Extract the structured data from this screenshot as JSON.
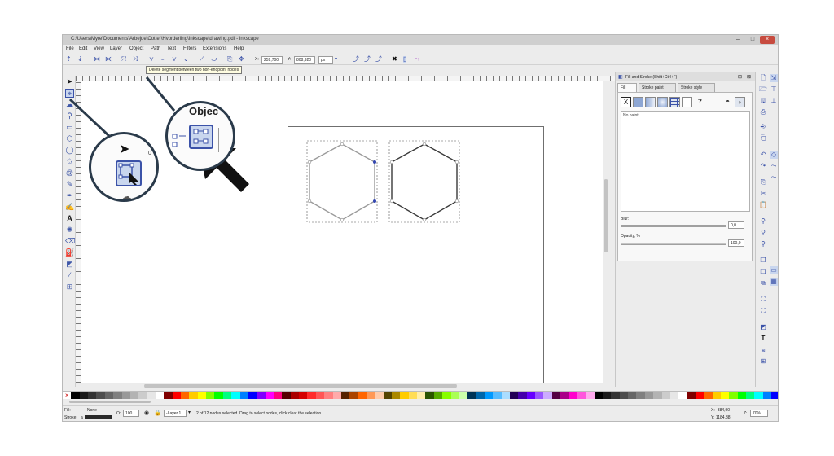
{
  "window": {
    "title": "C:\\Users\\Myre\\Documents\\Arbejde\\Cotter\\Hvorderling\\Inkscape\\drawing.pdf - Inkscape"
  },
  "menu": [
    "File",
    "Edit",
    "View",
    "Layer",
    "Object",
    "Path",
    "Text",
    "Filters",
    "Extensions",
    "Help"
  ],
  "node_toolbar": {
    "x_label": "X:",
    "x_value": "259,700",
    "y_label": "Y:",
    "y_value": "808,920",
    "unit": "px"
  },
  "tooltip": "Delete segment between two non-endpoint nodes",
  "fill_stroke": {
    "title": "Fill and Stroke (Shift+Ctrl+F)",
    "tabs": [
      "Fill",
      "Stroke paint",
      "Stroke style"
    ],
    "active_tab": "Fill",
    "paint_buttons": [
      "X",
      "?"
    ],
    "no_paint_label": "No paint",
    "blur_label": "Blur:",
    "blur_value": "0,0",
    "opacity_label": "Opacity, %",
    "opacity_value": "100,0"
  },
  "magnifier": {
    "objects_label": "Objec"
  },
  "status": {
    "fill_label": "Fill:",
    "fill_value": "None",
    "stroke_label": "Stroke:",
    "stroke_value": "a",
    "opacity_o": "O:",
    "opacity_value": "100",
    "layer": "-Layer 1",
    "message": "2 of 12 nodes selected. Drag to select nodes, click clear the selection",
    "x_coord": "X: -384,90",
    "y_coord": "Y: 1184,88",
    "zoom_label": "Z:",
    "zoom_value": "70%"
  },
  "palette_colors": [
    "#000000",
    "#1a1a1a",
    "#333333",
    "#4d4d4d",
    "#666666",
    "#808080",
    "#999999",
    "#b3b3b3",
    "#cccccc",
    "#e6e6e6",
    "#ffffff",
    "#800000",
    "#ff0000",
    "#ff6600",
    "#ffcc00",
    "#ffff00",
    "#80ff00",
    "#00ff00",
    "#00ff80",
    "#00ffff",
    "#0080ff",
    "#0000ff",
    "#8000ff",
    "#ff00ff",
    "#ff0080",
    "#550000",
    "#aa0000",
    "#d40000",
    "#ff2a2a",
    "#ff5555",
    "#ff8080",
    "#ffaaaa",
    "#552200",
    "#aa4400",
    "#ff6600",
    "#ff9955",
    "#ffccaa",
    "#554400",
    "#aa8800",
    "#ffcc00",
    "#ffdd55",
    "#ffeeaa",
    "#2b5500",
    "#55aa00",
    "#88ff00",
    "#aaff55",
    "#ccffaa",
    "#003355",
    "#0066aa",
    "#0099ff",
    "#55bbff",
    "#aaddff",
    "#220055",
    "#4400aa",
    "#6600ff",
    "#9955ff",
    "#ccaaff",
    "#550044",
    "#aa0088",
    "#ff00cc",
    "#ff55dd",
    "#ffaaee",
    "#000000",
    "#1a1a1a",
    "#333333",
    "#4d4d4d",
    "#666666",
    "#808080",
    "#999999",
    "#b3b3b3",
    "#cccccc",
    "#e6e6e6",
    "#ffffff",
    "#800000",
    "#ff0000",
    "#ff6600",
    "#ffcc00",
    "#ffff00",
    "#80ff00",
    "#00ff00",
    "#00ff80",
    "#00ffff",
    "#0080ff",
    "#0000ff"
  ]
}
